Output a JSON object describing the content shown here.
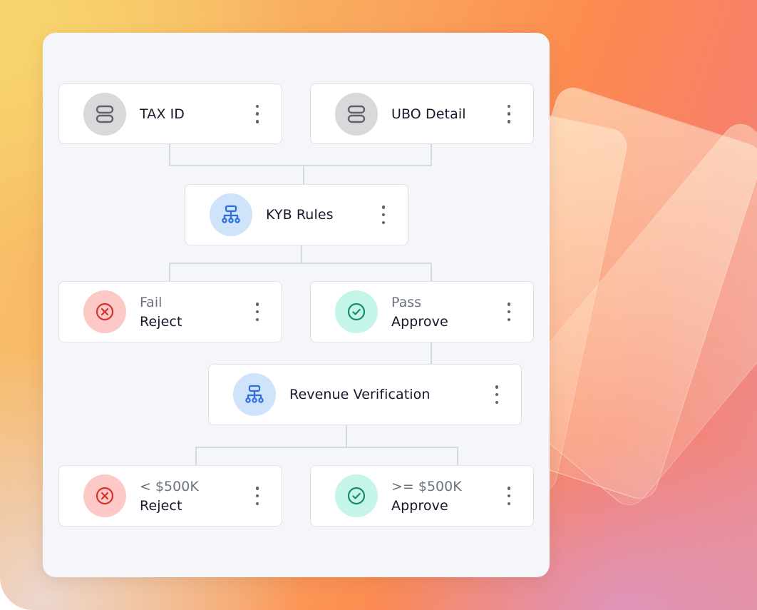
{
  "nodes": {
    "tax_id": {
      "label": "TAX ID",
      "icon": "database-icon"
    },
    "ubo_detail": {
      "label": "UBO Detail",
      "icon": "database-icon"
    },
    "kyb_rules": {
      "label": "KYB Rules",
      "icon": "hierarchy-icon"
    },
    "fail_reject": {
      "condition": "Fail",
      "label": "Reject",
      "icon": "x-circle-icon"
    },
    "pass_approve": {
      "condition": "Pass",
      "label": "Approve",
      "icon": "check-circle-icon"
    },
    "revenue_verification": {
      "label": "Revenue Verification",
      "icon": "hierarchy-icon"
    },
    "low_reject": {
      "condition": "< $500K",
      "label": "Reject",
      "icon": "x-circle-icon"
    },
    "high_approve": {
      "condition": ">= $500K",
      "label": "Approve",
      "icon": "check-circle-icon"
    }
  },
  "colors": {
    "grey_icon_bg": "#d9d9d9",
    "blue_icon_bg": "#cfe3fb",
    "red_icon_bg": "#fdc9c6",
    "green_icon_bg": "#c5f5e8",
    "blue_icon": "#2f6fdc",
    "red_icon": "#d6322b",
    "green_icon": "#178a68"
  }
}
